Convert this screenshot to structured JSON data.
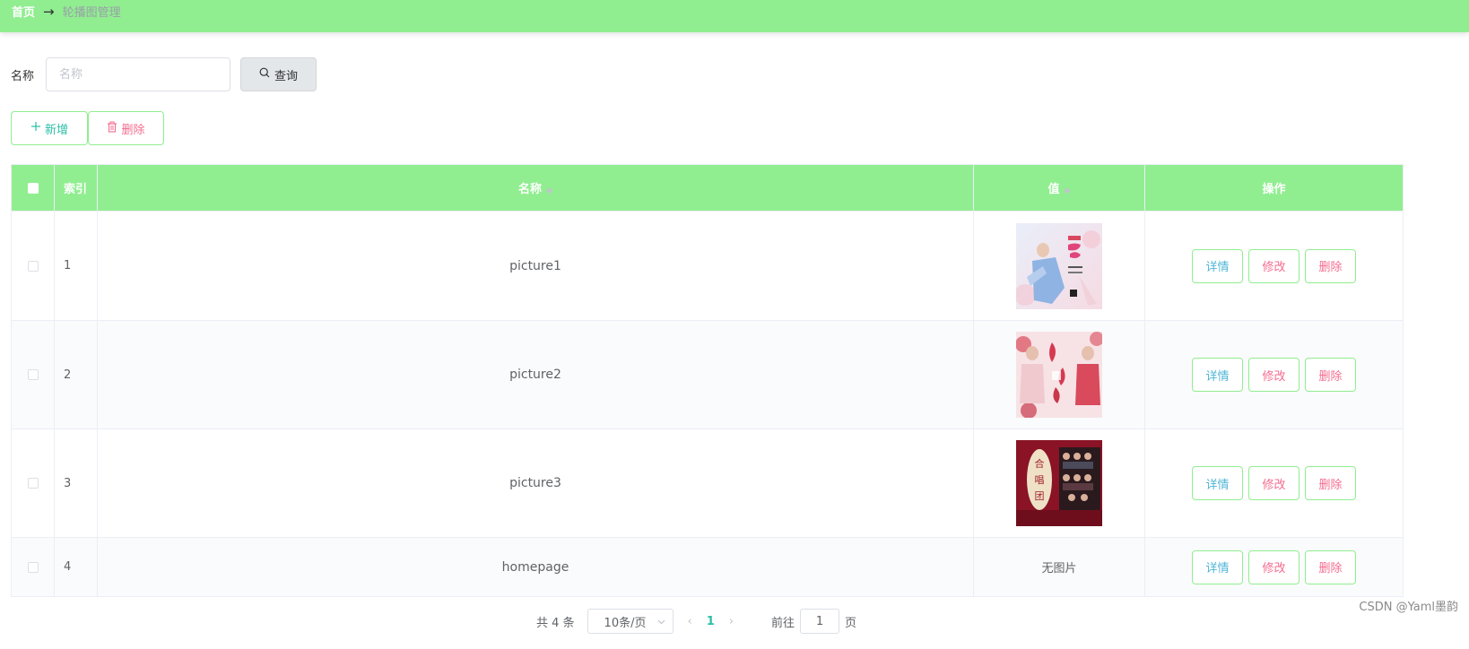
{
  "breadcrumb": {
    "home": "首页",
    "separator": "→",
    "current": "轮播图管理"
  },
  "search": {
    "label": "名称",
    "placeholder": "名称",
    "value": "",
    "button": "查询"
  },
  "actions": {
    "add": "新增",
    "delete": "删除"
  },
  "table": {
    "headers": {
      "index": "索引",
      "name": "名称",
      "value": "值",
      "ops": "操作"
    },
    "rows": [
      {
        "index": "1",
        "name": "picture1",
        "image": "poster-light-blue",
        "no_image": ""
      },
      {
        "index": "2",
        "name": "picture2",
        "image": "poster-pink-red",
        "no_image": ""
      },
      {
        "index": "3",
        "name": "picture3",
        "image": "poster-dark-red",
        "no_image": ""
      },
      {
        "index": "4",
        "name": "homepage",
        "image": "",
        "no_image": "无图片"
      }
    ],
    "op_labels": {
      "detail": "详情",
      "edit": "修改",
      "delete": "删除"
    }
  },
  "pagination": {
    "total": "共 4 条",
    "page_size": "10条/页",
    "current_page": "1",
    "goto_prefix": "前往",
    "goto_value": "1",
    "goto_suffix": "页"
  },
  "watermark": "CSDN @Yaml墨韵",
  "colors": {
    "header": "#90ee90",
    "accent": "#2bbfa6",
    "danger": "#f56c8f",
    "info": "#4fb6d6"
  },
  "icons": {
    "query": "search-icon",
    "add": "plus-icon",
    "delete": "trash-icon",
    "sort": "sort-caret-icon"
  }
}
